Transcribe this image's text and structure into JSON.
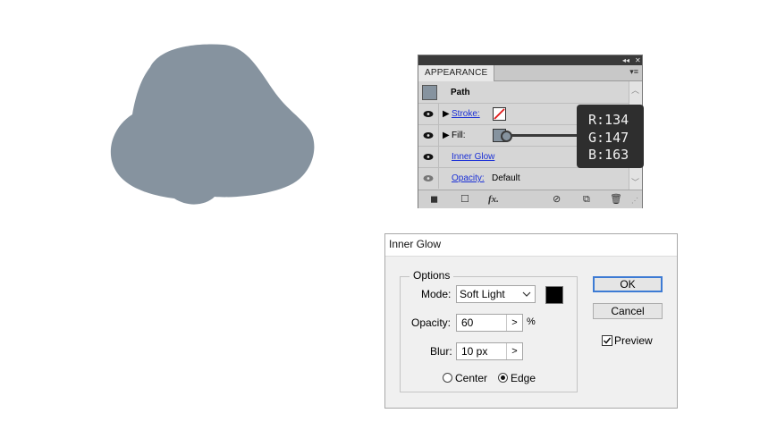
{
  "colors": {
    "shape_fill": "#86939f",
    "panel_bg": "#d6d6d6",
    "tooltip_bg": "#2e2e2e",
    "default_button_border": "#3d7bd4"
  },
  "appearance_panel": {
    "tab_label": "APPEARANCE",
    "object_label": "Path",
    "rows": {
      "stroke_label": "Stroke:",
      "fill_label": "Fill:",
      "effect_label": "Inner Glow",
      "opacity_label": "Opacity:",
      "opacity_value": "Default"
    }
  },
  "rgb_tooltip": {
    "r": "R:134",
    "g": "G:147",
    "b": "B:163"
  },
  "dialog": {
    "title": "Inner Glow",
    "options_legend": "Options",
    "mode_label": "Mode:",
    "mode_value": "Soft Light",
    "opacity_label": "Opacity:",
    "opacity_value": "60",
    "opacity_unit": "%",
    "blur_label": "Blur:",
    "blur_value": "10 px",
    "center_label": "Center",
    "edge_label": "Edge",
    "ok_label": "OK",
    "cancel_label": "Cancel",
    "preview_label": "Preview"
  },
  "icons": [
    "eye-icon",
    "disclosure-triangle-icon",
    "none-stroke-icon",
    "fx-icon",
    "clear-icon",
    "duplicate-icon",
    "trash-icon",
    "chevron-down-icon",
    "step-right-icon"
  ]
}
